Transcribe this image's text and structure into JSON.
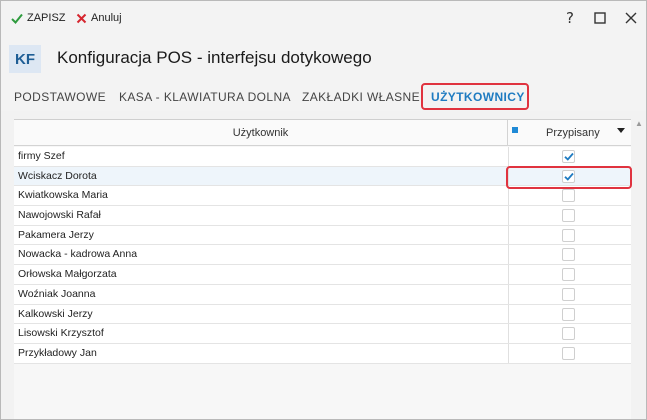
{
  "toolbar": {
    "save_label": "ZAPISZ",
    "cancel_label": "Anuluj",
    "help_symbol": "?"
  },
  "header": {
    "badge": "KF",
    "title": "Konfiguracja POS - interfejsu dotykowego"
  },
  "tabs": [
    {
      "label": "PODSTAWOWE",
      "active": false
    },
    {
      "label": "KASA - KLAWIATURA DOLNA",
      "active": false
    },
    {
      "label": "ZAKŁADKI WŁASNE",
      "active": false
    },
    {
      "label": "UŻYTKOWNICY",
      "active": true
    }
  ],
  "grid": {
    "col_user": "Użytkownik",
    "col_assigned": "Przypisany",
    "rows": [
      {
        "name": "firmy Szef",
        "assigned": true
      },
      {
        "name": "Wciskacz Dorota",
        "assigned": true
      },
      {
        "name": "Kwiatkowska Maria",
        "assigned": false
      },
      {
        "name": "Nawojowski Rafał",
        "assigned": false
      },
      {
        "name": "Pakamera Jerzy",
        "assigned": false
      },
      {
        "name": "Nowacka - kadrowa Anna",
        "assigned": false
      },
      {
        "name": "Orłowska Małgorzata",
        "assigned": false
      },
      {
        "name": "Woźniak Joanna",
        "assigned": false
      },
      {
        "name": "Kalkowski Jerzy",
        "assigned": false
      },
      {
        "name": "Lisowski Krzysztof",
        "assigned": false
      },
      {
        "name": "Przykładowy Jan",
        "assigned": false
      }
    ]
  },
  "colors": {
    "accent": "#1f7bc1",
    "highlight": "#e0333f",
    "save_check": "#2e9b3e",
    "cancel_x": "#d6262f"
  }
}
